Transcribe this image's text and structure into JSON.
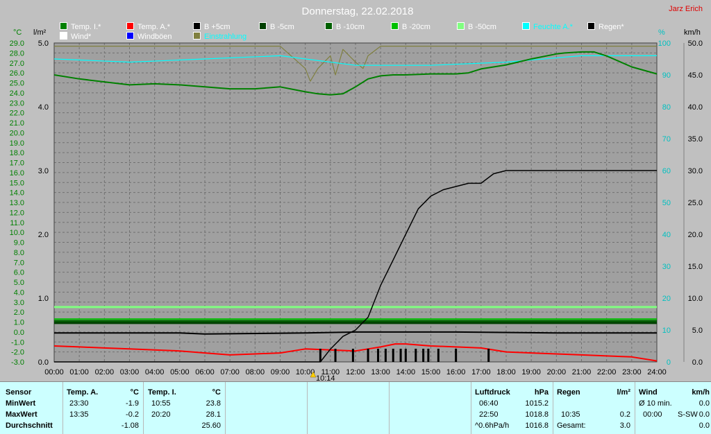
{
  "header": {
    "title": "Donnerstag, 22.02.2018",
    "author": "Jarz Erich"
  },
  "colors": {
    "plot_bg": "#a0a0a0",
    "grid": "#666666",
    "left_axis": "#008000",
    "right_axis_pct": "#00c0c0",
    "right_axis_kmh": "#000000",
    "stats_bg": "#ccffff"
  },
  "axis_titles": {
    "left_temp": "°C",
    "left_rain": "l/m²",
    "right_pct": "%",
    "right_kmh": "km/h"
  },
  "legend": [
    {
      "label": "Temp. I.*",
      "color": "#008000"
    },
    {
      "label": "Temp. A.*",
      "color": "#ff0000"
    },
    {
      "label": "B +5cm",
      "color": "#000000"
    },
    {
      "label": "B -5cm",
      "color": "#004000"
    },
    {
      "label": "B -10cm",
      "color": "#006000"
    },
    {
      "label": "B -20cm",
      "color": "#00c000"
    },
    {
      "label": "B -50cm",
      "color": "#80ff80"
    },
    {
      "label": "Feuchte A.*",
      "color": "#00ffff"
    },
    {
      "label": "Regen*",
      "color": "#000000"
    },
    {
      "label": "Wind*",
      "color": "#ffffff"
    },
    {
      "label": "Windböen",
      "color": "#0000ff"
    },
    {
      "label": "Einstrahlung",
      "color": "#808040"
    }
  ],
  "chart_data": {
    "type": "line",
    "x_unit": "time of day",
    "x_ticks": [
      "00:00",
      "01:00",
      "02:00",
      "03:00",
      "04:00",
      "05:00",
      "06:00",
      "07:00",
      "08:00",
      "09:00",
      "10:00",
      "11:00",
      "12:00",
      "13:00",
      "14:00",
      "15:00",
      "16:00",
      "17:00",
      "18:00",
      "19:00",
      "20:00",
      "21:00",
      "22:00",
      "23:00",
      "24:00"
    ],
    "axes": {
      "temp": {
        "ylim": [
          -3,
          29
        ],
        "ticks": [
          "29.0",
          "28.0",
          "27.0",
          "26.0",
          "25.0",
          "24.0",
          "23.0",
          "22.0",
          "21.0",
          "20.0",
          "19.0",
          "18.0",
          "17.0",
          "16.0",
          "15.0",
          "14.0",
          "13.0",
          "12.0",
          "11.0",
          "10.0",
          "9.0",
          "8.0",
          "7.0",
          "6.0",
          "5.0",
          "4.0",
          "3.0",
          "2.0",
          "1.0",
          "0.0",
          "-1.0",
          "-2.0",
          "-3.0"
        ]
      },
      "rain": {
        "ylim": [
          0,
          5
        ],
        "ticks": [
          "5.0",
          "4.0",
          "3.0",
          "2.0",
          "1.0",
          "0.0"
        ]
      },
      "humidity": {
        "ylim": [
          0,
          100
        ],
        "ticks": [
          "100",
          "90",
          "80",
          "70",
          "60",
          "50",
          "40",
          "30",
          "20",
          "10",
          "0"
        ]
      },
      "wind": {
        "ylim": [
          0,
          50
        ],
        "ticks": [
          "50.0",
          "45.0",
          "40.0",
          "35.0",
          "30.0",
          "25.0",
          "20.0",
          "15.0",
          "10.0",
          "5.0",
          "0.0"
        ]
      }
    },
    "series": [
      {
        "name": "Temp. I.*",
        "axis": "temp",
        "color": "#008000",
        "x": [
          0,
          1,
          2,
          3,
          4,
          5,
          6,
          7,
          8,
          9,
          10,
          10.5,
          11,
          11.5,
          12,
          12.5,
          13,
          13.5,
          14,
          15,
          16,
          16.5,
          17,
          18,
          19,
          20,
          20.33,
          21,
          21.5,
          22,
          23,
          24
        ],
        "y": [
          25.8,
          25.4,
          25.1,
          24.8,
          24.9,
          24.8,
          24.6,
          24.4,
          24.4,
          24.6,
          24.1,
          23.9,
          23.8,
          23.9,
          24.6,
          25.4,
          25.7,
          25.8,
          25.8,
          25.9,
          25.9,
          26.0,
          26.4,
          26.8,
          27.4,
          27.9,
          28.0,
          28.1,
          28.1,
          27.7,
          26.6,
          25.9
        ]
      },
      {
        "name": "Temp. A.*",
        "axis": "temp",
        "color": "#ff0000",
        "x": [
          0,
          1,
          2,
          3,
          4,
          5,
          6,
          7,
          8,
          9,
          10,
          11,
          12,
          12.5,
          13,
          13.58,
          14,
          15,
          16,
          17,
          18,
          19,
          20,
          21,
          22,
          23,
          23.5,
          24
        ],
        "y": [
          -1.4,
          -1.5,
          -1.6,
          -1.7,
          -1.8,
          -1.9,
          -2.1,
          -2.3,
          -2.2,
          -2.1,
          -1.7,
          -1.8,
          -1.9,
          -1.7,
          -1.5,
          -1.2,
          -1.2,
          -1.4,
          -1.5,
          -1.6,
          -2.0,
          -2.1,
          -2.2,
          -2.3,
          -2.4,
          -2.5,
          -2.7,
          -2.9
        ]
      },
      {
        "name": "B +5cm",
        "axis": "temp",
        "color": "#000000",
        "x": [
          0,
          5,
          6,
          10,
          12,
          16,
          20,
          24
        ],
        "y": [
          -0.1,
          -0.1,
          -0.2,
          -0.1,
          0.0,
          0.0,
          -0.1,
          -0.1
        ]
      },
      {
        "name": "B -5cm",
        "axis": "temp",
        "color": "#004000",
        "x": [
          0,
          24
        ],
        "y": [
          0.9,
          0.9
        ]
      },
      {
        "name": "B -10cm",
        "axis": "temp",
        "color": "#006000",
        "x": [
          0,
          24
        ],
        "y": [
          1.1,
          1.1
        ]
      },
      {
        "name": "B -20cm",
        "axis": "temp",
        "color": "#00c000",
        "x": [
          0,
          24
        ],
        "y": [
          1.3,
          1.3
        ]
      },
      {
        "name": "B -50cm",
        "axis": "temp",
        "color": "#80ff80",
        "x": [
          0,
          24
        ],
        "y": [
          2.5,
          2.5
        ]
      },
      {
        "name": "Feuchte A.*",
        "axis": "humidity",
        "color": "#00ffff",
        "x": [
          0,
          3,
          6,
          9,
          12,
          15,
          18,
          21,
          24
        ],
        "y": [
          95,
          94,
          95,
          96,
          93,
          93,
          94,
          96,
          96
        ]
      },
      {
        "name": "Regen*",
        "axis": "rain",
        "color": "#000000",
        "x": [
          0,
          10.6,
          11,
          11.5,
          12,
          12.5,
          13,
          13.5,
          14,
          14.5,
          15,
          15.5,
          16,
          16.5,
          17,
          17.5,
          18,
          18.5,
          24
        ],
        "y": [
          0,
          0,
          0.2,
          0.4,
          0.5,
          0.7,
          1.2,
          1.6,
          2.0,
          2.4,
          2.6,
          2.7,
          2.75,
          2.8,
          2.8,
          2.95,
          3.0,
          3.0,
          3.0
        ]
      },
      {
        "name": "Einstrahlung",
        "axis": "wind",
        "color": "#808040",
        "x": [
          0,
          9,
          10,
          10.2,
          10.5,
          11,
          11.2,
          11.5,
          12,
          12.3,
          12.5,
          13,
          14,
          15,
          16,
          17,
          18,
          24
        ],
        "y": [
          49.5,
          49.5,
          46,
          44,
          46,
          48,
          45,
          49,
          47,
          46,
          48,
          49.5,
          49.5,
          49.5,
          49.5,
          49.5,
          49.5,
          49.5
        ]
      }
    ],
    "rain_events": [
      10.6,
      11.2,
      11.9,
      12.5,
      12.9,
      13.2,
      13.5,
      13.8,
      14.0,
      14.4,
      14.7,
      14.9,
      15.3,
      16.0,
      17.3
    ],
    "marker": {
      "time": "10:14"
    }
  },
  "stats": {
    "sensor": {
      "header": "Sensor",
      "min": "MinWert",
      "max": "MaxWert",
      "avg": "Durchschnitt"
    },
    "temp_a": {
      "header": "Temp. A.",
      "unit": "°C",
      "min_time": "23:30",
      "min": "-1.9",
      "max_time": "13:35",
      "max": "-0.2",
      "avg": "-1.08"
    },
    "temp_i": {
      "header": "Temp. I.",
      "unit": "°C",
      "min_time": "10:55",
      "min": "23.8",
      "max_time": "20:20",
      "max": "28.1",
      "avg": "25.60"
    },
    "pressure": {
      "header": "Luftdruck",
      "unit": "hPa",
      "min_time": "06:40",
      "min": "1015.2",
      "max_time": "22:50",
      "max": "1018.8",
      "trend": "^0.6hPa/h",
      "avg": "1016.8"
    },
    "rain": {
      "header": "Regen",
      "unit": "l/m²",
      "max_time": "10:35",
      "max": "0.2",
      "total_label": "Gesamt:",
      "total": "3.0"
    },
    "wind": {
      "header": "Wind",
      "unit": "km/h",
      "avg_label": "Ø 10 min.",
      "avg": "0.0",
      "max_time": "00:00",
      "dir": "S-SW",
      "max": "0.0",
      "avg2": "0.0"
    }
  }
}
